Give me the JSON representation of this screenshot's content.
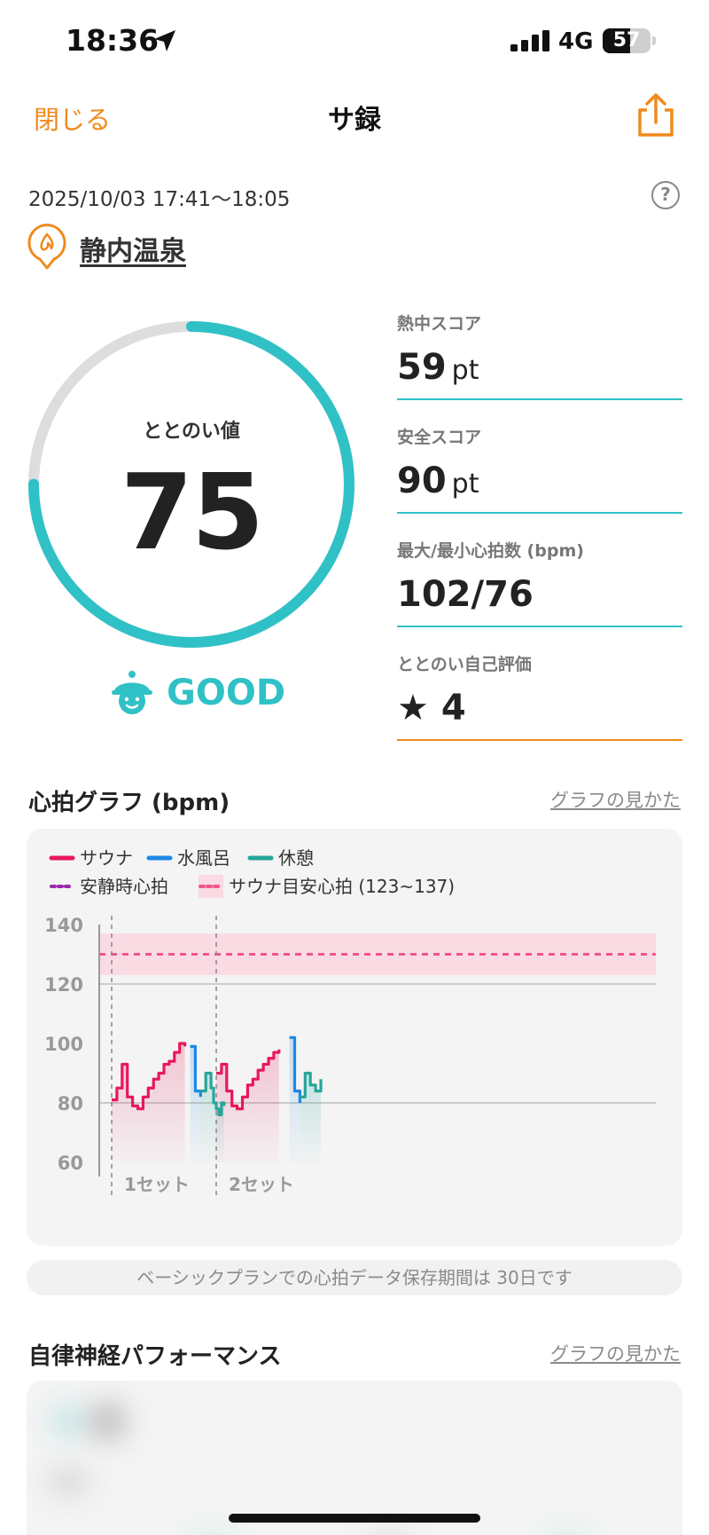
{
  "status_bar": {
    "time": "18:36",
    "network": "4G",
    "battery": "57",
    "battery_level": 0.57
  },
  "nav": {
    "close_label": "閉じる",
    "title": "サ録"
  },
  "session": {
    "date_range": "2025/10/03 17:41～18:05",
    "facility": "静内温泉"
  },
  "totonoi": {
    "label": "ととのい値",
    "value": "75",
    "rating": "GOOD",
    "progress": 0.75
  },
  "scores": [
    {
      "label": "熱中スコア",
      "value": "59",
      "unit": "pt"
    },
    {
      "label": "安全スコア",
      "value": "90",
      "unit": "pt"
    },
    {
      "label": "最大/最小心拍数 (bpm)",
      "value": "102/76",
      "unit": ""
    },
    {
      "label": "ととのい自己評価",
      "value": "4",
      "unit": ""
    }
  ],
  "heart_section": {
    "title": "心拍グラフ (bpm)",
    "guide_link": "グラフの見かた",
    "notice": "ベーシックプランでの心拍データ保存期間は 30日です"
  },
  "chart_data": {
    "type": "line",
    "legend": [
      {
        "name": "サウナ",
        "color": "#e8185a"
      },
      {
        "name": "水風呂",
        "color": "#1e88e5"
      },
      {
        "name": "休憩",
        "color": "#26a69a"
      },
      {
        "name": "安静時心拍",
        "color": "#9c27b0"
      },
      {
        "name": "サウナ目安心拍 (123~137)",
        "color": "#f0568a"
      }
    ],
    "ylim": [
      60,
      140
    ],
    "yticks": [
      "140",
      "120",
      "100",
      "80",
      "60"
    ],
    "target_band": [
      123,
      137
    ],
    "target_line": 130,
    "resting_line": 80,
    "sets": [
      "1セット",
      "2セット"
    ],
    "series": [
      {
        "name": "サウナ",
        "color": "#e8185a",
        "segments": [
          [
            [
              0,
              81
            ],
            [
              1,
              85
            ],
            [
              2,
              93
            ],
            [
              3,
              82
            ],
            [
              4,
              79
            ],
            [
              5,
              78
            ],
            [
              6,
              82
            ],
            [
              7,
              85
            ],
            [
              8,
              88
            ],
            [
              9,
              90
            ],
            [
              10,
              93
            ],
            [
              11,
              94
            ],
            [
              12,
              97
            ],
            [
              13,
              100
            ],
            [
              14,
              99
            ]
          ],
          [
            [
              20,
              90
            ],
            [
              21,
              93
            ],
            [
              22,
              84
            ],
            [
              23,
              79
            ],
            [
              24,
              78
            ],
            [
              25,
              82
            ],
            [
              26,
              86
            ],
            [
              27,
              88
            ],
            [
              28,
              91
            ],
            [
              29,
              93
            ],
            [
              30,
              95
            ],
            [
              31,
              97
            ],
            [
              32,
              98
            ]
          ]
        ]
      },
      {
        "name": "水風呂",
        "color": "#1e88e5",
        "segments": [
          [
            [
              15,
              99
            ],
            [
              16,
              84
            ],
            [
              17,
              82
            ]
          ],
          [
            [
              34,
              102
            ],
            [
              35,
              84
            ],
            [
              36,
              80
            ]
          ]
        ]
      },
      {
        "name": "休憩",
        "color": "#26a69a",
        "segments": [
          [
            [
              17,
              84
            ],
            [
              18,
              90
            ],
            [
              19,
              85
            ],
            [
              19.5,
              80
            ],
            [
              20,
              78
            ],
            [
              20.5,
              76
            ],
            [
              21,
              80
            ],
            [
              21.5,
              79
            ]
          ],
          [
            [
              36,
              82
            ],
            [
              37,
              90
            ],
            [
              38,
              86
            ],
            [
              39,
              84
            ],
            [
              40,
              88
            ]
          ]
        ]
      }
    ]
  },
  "autonomic_section": {
    "title": "自律神経パフォーマンス",
    "guide_link": "グラフの見かた"
  }
}
